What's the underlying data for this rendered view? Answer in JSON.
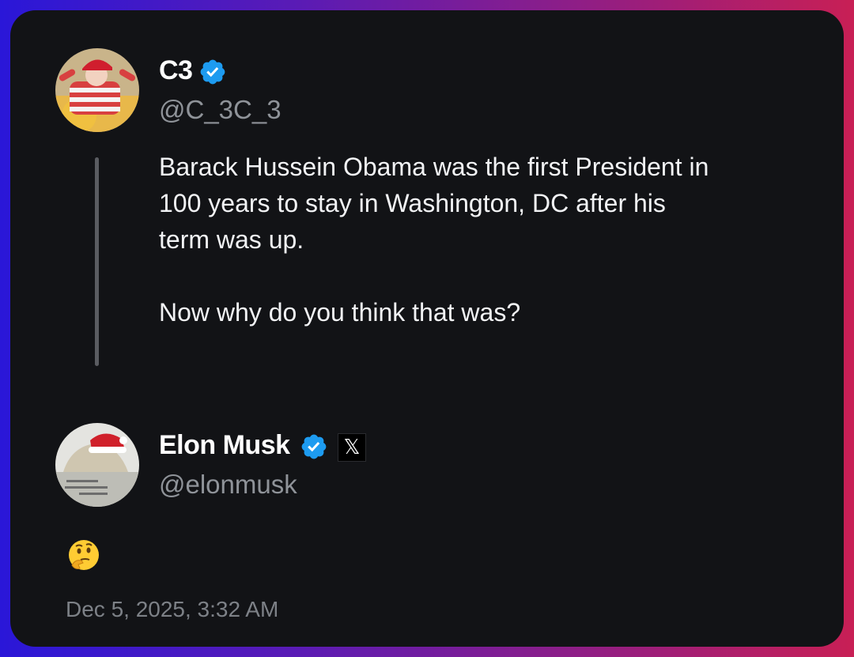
{
  "original_post": {
    "display_name": "C3",
    "handle": "@C_3C_3",
    "verified": true,
    "text": "Barack Hussein Obama was the first President in\n100 years to stay in Washington, DC after his\nterm was up.\n\nNow why do you think that was?"
  },
  "reply": {
    "display_name": "Elon Musk",
    "handle": "@elonmusk",
    "verified": true,
    "affiliate_badge": "𝕏",
    "body_emoji": "thinking-face-emoji",
    "timestamp": "Dec 5, 2025, 3:32 AM"
  },
  "colors": {
    "card_background": "#121316",
    "verified_blue": "#1d9bf0",
    "handle_gray": "#8f9399",
    "thread_line": "#5a5c61"
  }
}
